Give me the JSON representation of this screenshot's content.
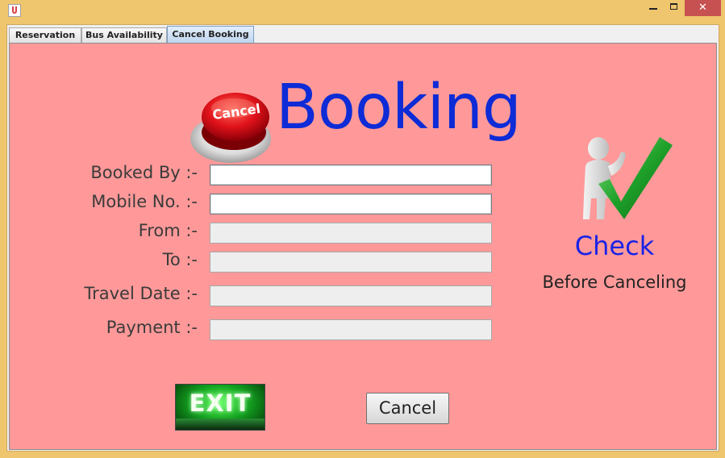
{
  "window": {
    "title": "",
    "controls": {
      "minimize": "minimize",
      "maximize": "maximize",
      "close": "close"
    }
  },
  "tabs": [
    {
      "label": "Reservation",
      "selected": false
    },
    {
      "label": "Bus Availability",
      "selected": false
    },
    {
      "label": "Cancel Booking",
      "selected": true
    }
  ],
  "header": {
    "icon_text": "Cancel",
    "title": "Booking"
  },
  "form": {
    "booked_by": {
      "label": "Booked By :-",
      "value": ""
    },
    "mobile": {
      "label": "Mobile No. :-",
      "value": ""
    },
    "from": {
      "label": "From :-",
      "value": ""
    },
    "to": {
      "label": "To :-",
      "value": ""
    },
    "travel_date": {
      "label": "Travel Date :-",
      "value": ""
    },
    "payment": {
      "label": "Payment :-",
      "value": ""
    }
  },
  "check_panel": {
    "title": "Check",
    "subtitle": "Before Canceling"
  },
  "buttons": {
    "exit_label": "EXIT",
    "cancel_label": "Cancel"
  },
  "colors": {
    "window_frame": "#efc56e",
    "panel_background": "#ff9999",
    "title_blue": "#0d2bd6",
    "check_blue": "#1a22e6",
    "close_red": "#c75050"
  }
}
